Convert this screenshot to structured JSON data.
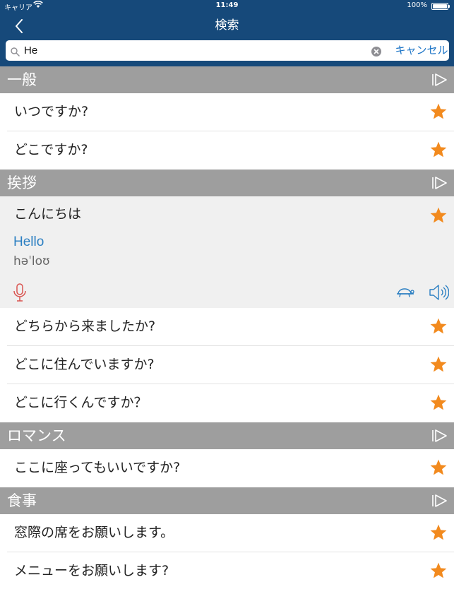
{
  "status_bar": {
    "carrier": "キャリア",
    "time": "11:49",
    "battery_percent": "100%",
    "battery_level": 1.0
  },
  "nav": {
    "title": "検索",
    "back_icon": "chevron-left-icon"
  },
  "search": {
    "value": "He",
    "cancel_label": "キャンセル"
  },
  "colors": {
    "nav_background": "#16497a",
    "section_header": "#9e9e9e",
    "star": "#f28a1e",
    "translation": "#2b7fc2",
    "mic": "#d9534f",
    "accent": "#1a73c6"
  },
  "sections": [
    {
      "title": "一般",
      "items": [
        {
          "phrase": "いつですか?"
        },
        {
          "phrase": "どこですか?"
        }
      ]
    },
    {
      "title": "挨拶",
      "items": [
        {
          "phrase": "こんにちは",
          "expanded": true,
          "translation": "Hello",
          "phonetic": "həˈloʊ"
        },
        {
          "phrase": "どちらから来ましたか?"
        },
        {
          "phrase": "どこに住んでいますか?"
        },
        {
          "phrase": "どこに行くんですか？"
        }
      ]
    },
    {
      "title": "ロマンス",
      "items": [
        {
          "phrase": "ここに座ってもいいですか?"
        }
      ]
    },
    {
      "title": "食事",
      "items": [
        {
          "phrase": "窓際の席をお願いします。"
        },
        {
          "phrase": "メニューをお願いします?"
        }
      ]
    }
  ]
}
